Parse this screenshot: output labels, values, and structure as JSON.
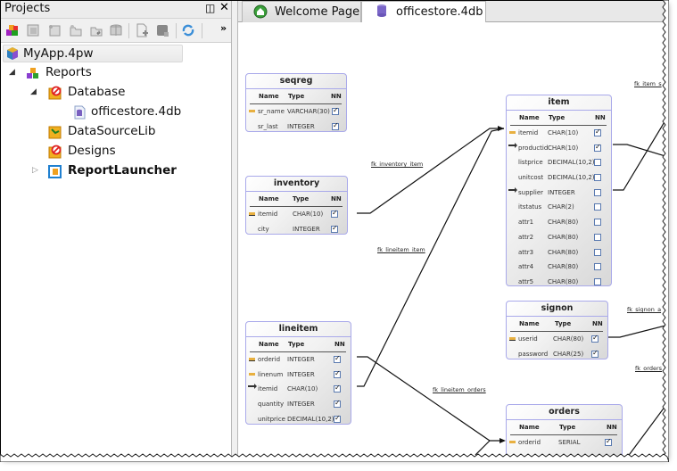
{
  "projects_panel": {
    "title": "Projects",
    "float_icon": "restore-window-icon",
    "close_icon": "close-icon",
    "toolbar": {
      "icons": [
        "new-project-icon",
        "open-file-icon",
        "new-item-icon",
        "new-folder-icon",
        "add-folder-icon",
        "database-icon",
        "new-document-icon",
        "add-database-icon",
        "refresh-sync-icon"
      ],
      "overflow_label": "»"
    },
    "tree": [
      {
        "label": "MyApp.4pw",
        "icon": "project-cube-icon",
        "level": 0,
        "selected": true
      },
      {
        "label": "Reports",
        "icon": "reports-blocks-icon",
        "level": 1,
        "expanded": true
      },
      {
        "label": "Database",
        "icon": "database-folder-icon",
        "level": 2,
        "expanded": true
      },
      {
        "label": "officestore.4db",
        "icon": "db-file-icon",
        "level": 3
      },
      {
        "label": "DataSourceLib",
        "icon": "datasource-lib-icon",
        "level": 2
      },
      {
        "label": "Designs",
        "icon": "designs-folder-icon",
        "level": 2
      },
      {
        "label": "ReportLauncher",
        "icon": "report-launcher-icon",
        "level": 2,
        "expanded": false,
        "bold": true
      }
    ]
  },
  "editor": {
    "tabs": [
      {
        "label": "Welcome Page",
        "icon": "home-icon",
        "active": false
      },
      {
        "label": "officestore.4db",
        "icon": "database-icon",
        "active": true
      }
    ]
  },
  "diagram": {
    "column_headers": {
      "name": "Name",
      "type": "Type",
      "nn": "NN"
    },
    "tables": {
      "seqreg": {
        "title": "seqreg",
        "rows": [
          {
            "name": "sr_name",
            "type": "VARCHAR(30)",
            "nn": true,
            "key": "primary"
          },
          {
            "name": "sr_last",
            "type": "INTEGER",
            "nn": true,
            "key": ""
          }
        ]
      },
      "inventory": {
        "title": "inventory",
        "rows": [
          {
            "name": "itemid",
            "type": "CHAR(10)",
            "nn": true,
            "key": "primary-foreign"
          },
          {
            "name": "city",
            "type": "INTEGER",
            "nn": true,
            "key": ""
          }
        ]
      },
      "lineitem": {
        "title": "lineitem",
        "rows": [
          {
            "name": "orderid",
            "type": "INTEGER",
            "nn": true,
            "key": "primary-foreign"
          },
          {
            "name": "linenum",
            "type": "INTEGER",
            "nn": true,
            "key": "primary"
          },
          {
            "name": "itemid",
            "type": "CHAR(10)",
            "nn": true,
            "key": "foreign"
          },
          {
            "name": "quantity",
            "type": "INTEGER",
            "nn": true,
            "key": ""
          },
          {
            "name": "unitprice",
            "type": "DECIMAL(10,2)",
            "nn": true,
            "key": ""
          }
        ]
      },
      "item": {
        "title": "item",
        "rows": [
          {
            "name": "itemid",
            "type": "CHAR(10)",
            "nn": true,
            "key": "primary"
          },
          {
            "name": "productid",
            "type": "CHAR(10)",
            "nn": true,
            "key": "foreign"
          },
          {
            "name": "listprice",
            "type": "DECIMAL(10,2)",
            "nn": false,
            "key": ""
          },
          {
            "name": "unitcost",
            "type": "DECIMAL(10,2)",
            "nn": false,
            "key": ""
          },
          {
            "name": "supplier",
            "type": "INTEGER",
            "nn": false,
            "key": "foreign"
          },
          {
            "name": "itstatus",
            "type": "CHAR(2)",
            "nn": false,
            "key": ""
          },
          {
            "name": "attr1",
            "type": "CHAR(80)",
            "nn": false,
            "key": ""
          },
          {
            "name": "attr2",
            "type": "CHAR(80)",
            "nn": false,
            "key": ""
          },
          {
            "name": "attr3",
            "type": "CHAR(80)",
            "nn": false,
            "key": ""
          },
          {
            "name": "attr4",
            "type": "CHAR(80)",
            "nn": false,
            "key": ""
          },
          {
            "name": "attr5",
            "type": "CHAR(80)",
            "nn": false,
            "key": ""
          }
        ]
      },
      "signon": {
        "title": "signon",
        "rows": [
          {
            "name": "userid",
            "type": "CHAR(80)",
            "nn": true,
            "key": "primary-foreign"
          },
          {
            "name": "password",
            "type": "CHAR(25)",
            "nn": true,
            "key": ""
          }
        ]
      },
      "orders": {
        "title": "orders",
        "rows": [
          {
            "name": "orderid",
            "type": "SERIAL",
            "nn": true,
            "key": "primary"
          }
        ]
      }
    },
    "links": {
      "fk_inventory_item": "fk_inventory_item",
      "fk_lineitem_item": "fk_lineitem_item",
      "fk_lineitem_orders": "fk_lineitem_orders",
      "fk_item_s": "fk_item_s",
      "fk_signon_a": "fk_signon_a",
      "fk_orders": "fk_orders"
    }
  },
  "colors": {
    "table_border": "#a9a9ea",
    "panel_header": "#ececec"
  }
}
